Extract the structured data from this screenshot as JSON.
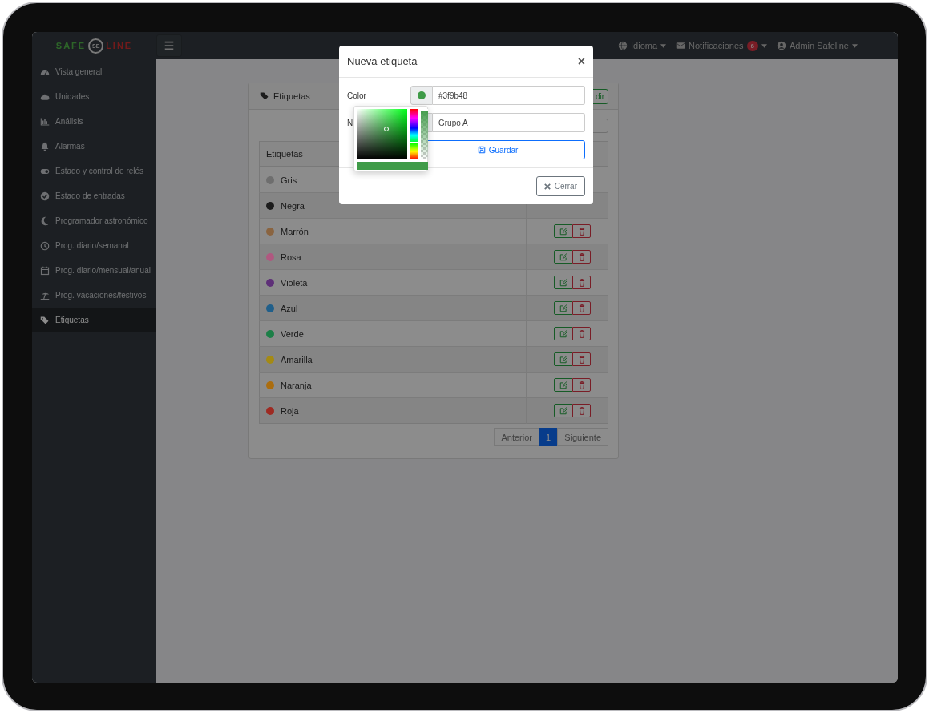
{
  "navbar": {
    "logo": {
      "left": "SAFE",
      "center": "SE",
      "right": "LINE"
    },
    "menu_items": [
      {
        "label": "Idioma"
      },
      {
        "label": "Notificaciones",
        "badge": "6"
      },
      {
        "label": "Admin Safeline"
      }
    ]
  },
  "sidebar": {
    "items": [
      {
        "label": "Vista general",
        "selected": false
      },
      {
        "label": "Unidades",
        "selected": false
      },
      {
        "label": "Análisis",
        "selected": false
      },
      {
        "label": "Alarmas",
        "selected": false
      },
      {
        "label": "Estado y control de relés",
        "selected": false
      },
      {
        "label": "Estado de entradas",
        "selected": false
      },
      {
        "label": "Programador astronómico",
        "selected": false
      },
      {
        "label": "Prog. diario/semanal",
        "selected": false
      },
      {
        "label": "Prog. diario/mensual/anual",
        "selected": false
      },
      {
        "label": "Prog. vacaciones/festivos",
        "selected": false
      },
      {
        "label": "Etiquetas",
        "selected": true
      }
    ]
  },
  "card": {
    "title": "Etiquetas",
    "add_button": "dir",
    "table": {
      "columns": [
        "Etiquetas"
      ],
      "rows": [
        {
          "name": "Gris",
          "color": "#6e6e6e"
        },
        {
          "name": "Negra",
          "color": "#1c1c1c",
          "buttons": false
        },
        {
          "name": "Marrón",
          "color": "#8a6440",
          "buttons": true
        },
        {
          "name": "Rosa",
          "color": "#b05880",
          "buttons": true
        },
        {
          "name": "Violeta",
          "color": "#5e2f78",
          "buttons": true
        },
        {
          "name": "Azul",
          "color": "#205f8a",
          "buttons": true
        },
        {
          "name": "Verde",
          "color": "#1c7f47",
          "buttons": true
        },
        {
          "name": "Amarilla",
          "color": "#a48a14",
          "buttons": true
        },
        {
          "name": "Naranja",
          "color": "#ab6d0e",
          "buttons": true
        },
        {
          "name": "Roja",
          "color": "#9e2a22",
          "buttons": true
        }
      ]
    },
    "pagination": [
      {
        "label": "Anterior",
        "selected": false
      },
      {
        "label": "1",
        "selected": true
      },
      {
        "label": "Siguiente",
        "selected": false
      }
    ]
  },
  "modal": {
    "title": "Nueva etiqueta",
    "close": "×",
    "fields": [
      {
        "label": "Color",
        "value": "#3f9b48"
      },
      {
        "label": "N",
        "value": "Grupo A"
      }
    ],
    "save_button": "Guardar",
    "close_button": "Cerrar",
    "color_picker": {
      "hue_slider": {
        "level": 0.35
      },
      "alpha_slider": {
        "level": 1
      }
    }
  }
}
